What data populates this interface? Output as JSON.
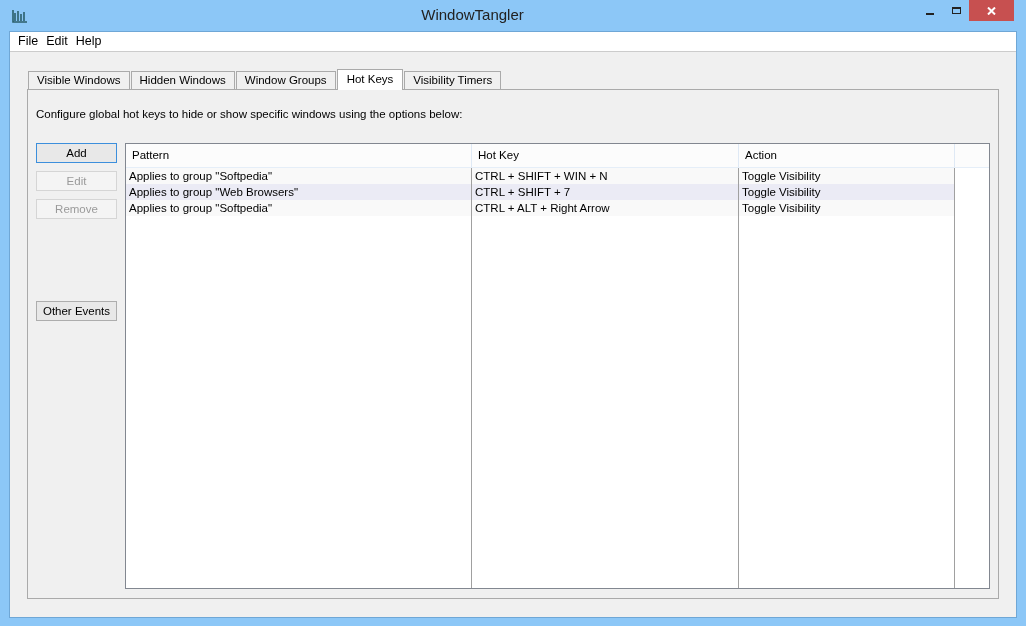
{
  "window": {
    "title": "WindowTangler"
  },
  "menu": [
    "File",
    "Edit",
    "Help"
  ],
  "tabs": [
    {
      "label": "Visible Windows",
      "selected": false
    },
    {
      "label": "Hidden Windows",
      "selected": false
    },
    {
      "label": "Window Groups",
      "selected": false
    },
    {
      "label": "Hot Keys",
      "selected": true
    },
    {
      "label": "Visibility Timers",
      "selected": false
    }
  ],
  "description": "Configure global hot keys to hide or show specific windows using the options below:",
  "buttons": [
    {
      "label": "Add",
      "disabled": false,
      "focused": true
    },
    {
      "label": "Edit",
      "disabled": true,
      "focused": false
    },
    {
      "label": "Remove",
      "disabled": true,
      "focused": false
    }
  ],
  "other_button": {
    "label": "Other Events"
  },
  "table": {
    "columns": [
      "Pattern",
      "Hot Key",
      "Action"
    ],
    "rows": [
      {
        "cells": [
          "Applies to group \"Softpedia\"",
          "CTRL + SHIFT + WIN + N",
          "Toggle Visibility"
        ],
        "selected": false
      },
      {
        "cells": [
          "Applies to group \"Web Browsers\"",
          "CTRL + SHIFT + 7",
          "Toggle Visibility"
        ],
        "selected": true
      },
      {
        "cells": [
          "Applies to group \"Softpedia\"",
          "CTRL + ALT + Right Arrow",
          "Toggle Visibility"
        ],
        "selected": false
      }
    ]
  }
}
